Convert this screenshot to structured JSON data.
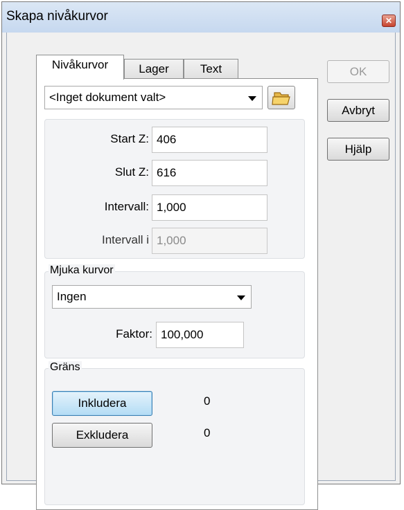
{
  "window": {
    "title": "Skapa nivåkurvor",
    "close_glyph": "✕"
  },
  "tabs": [
    {
      "label": "Nivåkurvor",
      "active": true
    },
    {
      "label": "Lager",
      "active": false
    },
    {
      "label": "Text",
      "active": false
    }
  ],
  "document_select": {
    "value": "<Inget dokument valt>"
  },
  "levels": {
    "start_z": {
      "label": "Start Z:",
      "value": "406"
    },
    "slut_z": {
      "label": "Slut Z:",
      "value": "616"
    },
    "intervall": {
      "label": "Intervall:",
      "value": "1,000"
    },
    "intervall_i": {
      "label": "Intervall i",
      "value": "1,000"
    }
  },
  "smooth": {
    "group_label": "Mjuka kurvor",
    "select_value": "Ingen",
    "factor_label": "Faktor:",
    "factor_value": "100,000"
  },
  "boundary": {
    "group_label": "Gräns",
    "include_label": "Inkludera",
    "include_count": "0",
    "exclude_label": "Exkludera",
    "exclude_count": "0"
  },
  "buttons": {
    "ok": "OK",
    "cancel": "Avbryt",
    "help": "Hjälp"
  },
  "colors": {
    "title_bar": "#c6d8ef",
    "close_red": "#c7432e",
    "focus_blue": "#3c7fb1"
  }
}
